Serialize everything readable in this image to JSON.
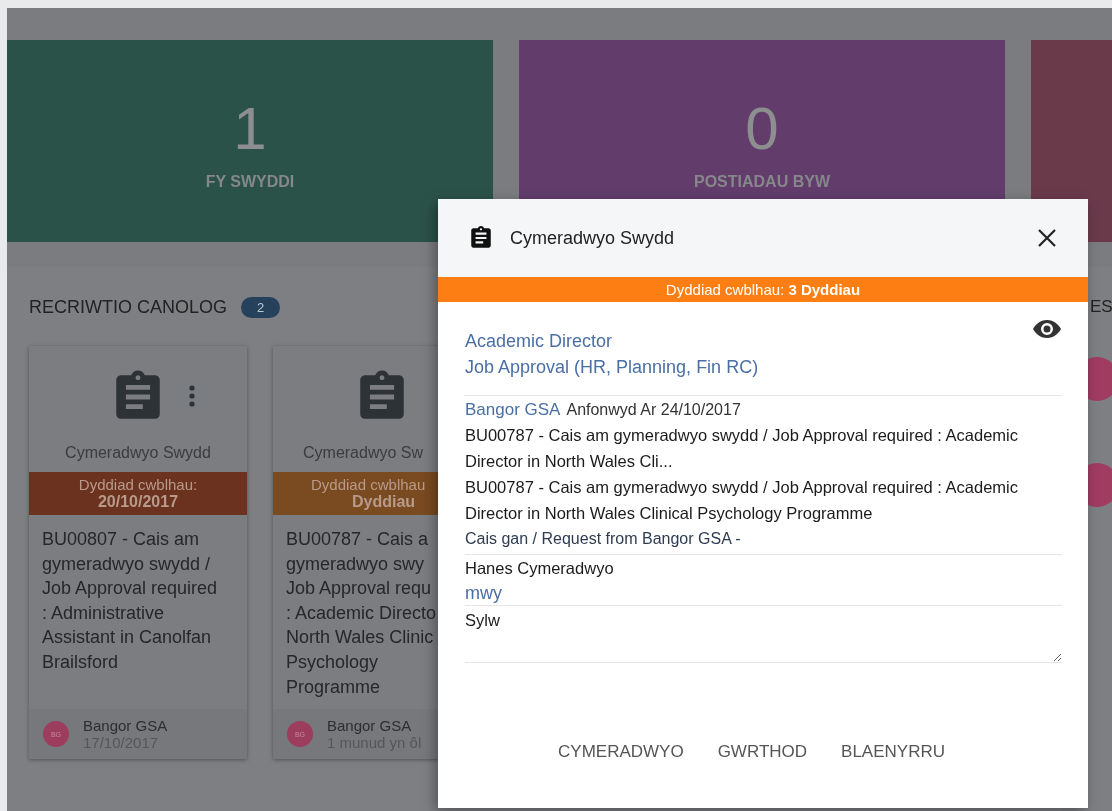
{
  "stat_tiles": [
    {
      "value": "1",
      "label": "FY SWYDDI",
      "color": "#2b5249"
    },
    {
      "value": "0",
      "label": "POSTIADAU BYW",
      "color": "#623d6c"
    },
    {
      "color": "#6a3a4b"
    }
  ],
  "section": {
    "title": "RECRIWTIO CANOLOG",
    "count": "2",
    "cards": [
      {
        "kind": "full",
        "icon_title": "Cymeradwyo Swydd",
        "due_label": "Dyddiad cwblhau:",
        "due_value": "20/10/2017",
        "color": "#6b3220",
        "description": "BU00807 - Cais am gymeradwyo swydd / Job Approval required : Administrative Assistant in Canolfan Brailsford",
        "avatar": "BG",
        "sender": "Bangor GSA",
        "date": "17/10/2017"
      },
      {
        "kind": "partial",
        "icon_title": "Cymeradwyo Sw",
        "due_label": "Dyddiad cwblhau",
        "due_value": "Dyddiau",
        "color": "#7a4a20",
        "description_lines": [
          "BU00787 - Cais a",
          "gymeradwyo swy",
          "Job Approval requ",
          ": Academic Directo",
          "North Wales Clinic",
          "Psychology",
          "Programme"
        ],
        "avatar": "BG",
        "sender": "Bangor GSA",
        "date": "1 munud yn ôl"
      }
    ]
  },
  "side_section": {
    "title": "ES"
  },
  "modal": {
    "title": "Cymeradwyo Swydd",
    "banner": "Dyddiad cwblhau: **3 Dyddiau**",
    "links": [
      "Academic Director",
      "Job Approval (HR, Planning, Fin RC)"
    ],
    "sender": "Bangor GSA",
    "sent": "Anfonwyd Ar 24/10/2017",
    "summary": "BU00787 - Cais am gymeradwyo swydd / Job Approval required : Academic Director in North Wales Cli...",
    "description": "BU00787 - Cais am gymeradwyo swydd / Job Approval required : Academic Director in North Wales Clinical Psychology Programme",
    "request": "Cais gan / Request from Bangor GSA -",
    "history_title": "Hanes Cymeradwyo",
    "more": "mwy",
    "comment": {
      "placeholder": "Sylw"
    },
    "actions": [
      "CYMERADWYO",
      "GWRTHOD",
      "BLAENYRRU"
    ]
  }
}
